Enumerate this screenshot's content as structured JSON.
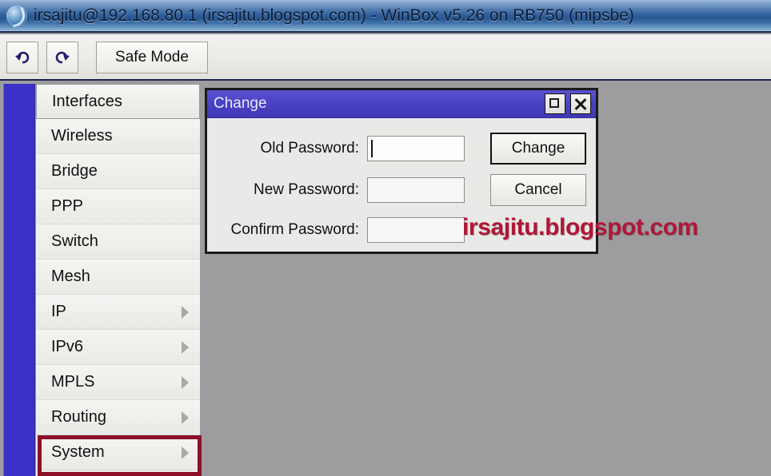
{
  "window": {
    "icon": "winbox-globe-icon",
    "title": "irsajitu@192.168.80.1 (irsajitu.blogspot.com) - WinBox v5.26 on RB750 (mipsbe)"
  },
  "toolbar": {
    "undo_icon": "undo-arrow-icon",
    "redo_icon": "redo-arrow-icon",
    "safe_mode_label": "Safe Mode"
  },
  "sidebar": {
    "items": [
      {
        "label": "Interfaces",
        "has_submenu": false,
        "selected": true
      },
      {
        "label": "Wireless",
        "has_submenu": false,
        "selected": false
      },
      {
        "label": "Bridge",
        "has_submenu": false,
        "selected": false
      },
      {
        "label": "PPP",
        "has_submenu": false,
        "selected": false
      },
      {
        "label": "Switch",
        "has_submenu": false,
        "selected": false
      },
      {
        "label": "Mesh",
        "has_submenu": false,
        "selected": false
      },
      {
        "label": "IP",
        "has_submenu": true,
        "selected": false
      },
      {
        "label": "IPv6",
        "has_submenu": true,
        "selected": false
      },
      {
        "label": "MPLS",
        "has_submenu": true,
        "selected": false
      },
      {
        "label": "Routing",
        "has_submenu": true,
        "selected": false
      },
      {
        "label": "System",
        "has_submenu": true,
        "selected": false,
        "annotated": true
      }
    ]
  },
  "dialog": {
    "title": "Change",
    "maximize_icon": "maximize-icon",
    "close_icon": "close-icon",
    "fields": [
      {
        "label": "Old Password:",
        "value": "",
        "focused": true
      },
      {
        "label": "New Password:",
        "value": "",
        "focused": false
      },
      {
        "label": "Confirm Password:",
        "value": "",
        "focused": false
      }
    ],
    "change_label": "Change",
    "cancel_label": "Cancel"
  },
  "watermark": {
    "text": "irsajitu.blogspot.com"
  },
  "colors": {
    "titlebar_blue": "#2f5f9c",
    "strip_blue": "#3b30c8",
    "dialog_titlebar": "#4a42c4",
    "desktop_gray": "#9d9d9f",
    "annotation_red": "#8b1028",
    "watermark_red": "#b01735"
  }
}
